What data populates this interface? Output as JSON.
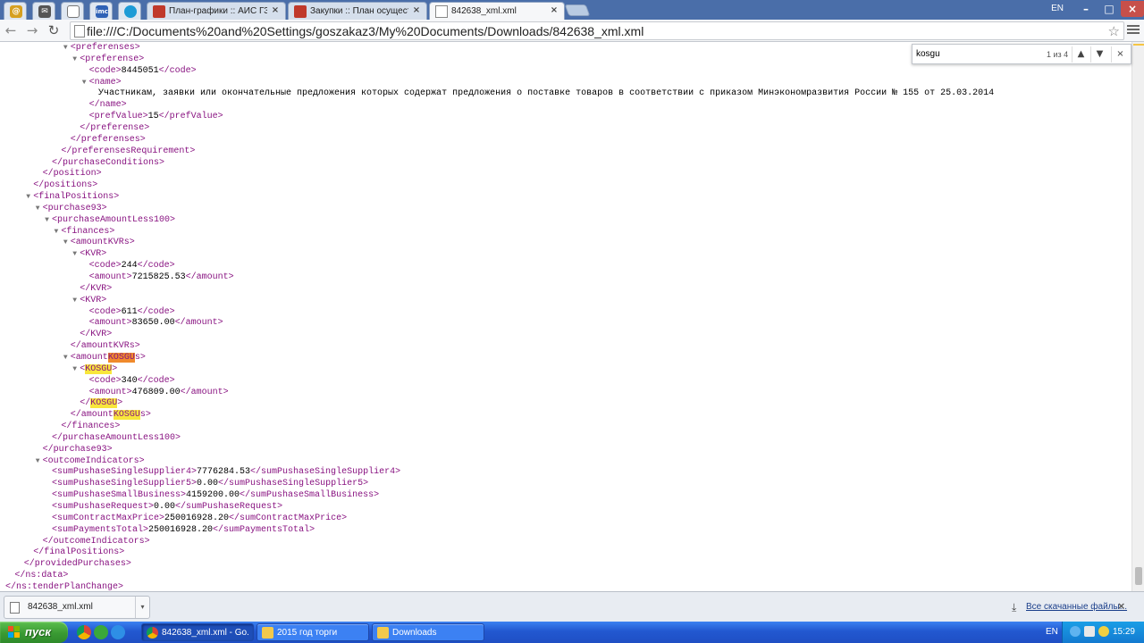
{
  "browser": {
    "tabs": [
      {
        "label": "План-графики :: АИС ГЗ",
        "close": "×"
      },
      {
        "label": "Закупки :: План осуществл",
        "close": "×"
      },
      {
        "label": "842638_xml.xml",
        "close": "×"
      }
    ],
    "ime_indicator": "EN",
    "window_buttons": {
      "minimize": "–",
      "maximize": "□",
      "close": "×"
    },
    "address": "file:///C:/Documents%20and%20Settings/goszakaz3/My%20Documents/Downloads/842638_xml.xml",
    "nav": {
      "back": "←",
      "forward": "→",
      "reload": "↻"
    }
  },
  "find_bar": {
    "query": "kosgu",
    "count": "1 из 4",
    "prev": "▲",
    "next": "▼",
    "close": "×"
  },
  "xml_lines": [
    {
      "indent": 7,
      "toggle": true,
      "segments": [
        [
          "tag",
          "<preferenses>"
        ]
      ]
    },
    {
      "indent": 8,
      "toggle": true,
      "segments": [
        [
          "tag",
          "<preferense>"
        ]
      ]
    },
    {
      "indent": 9,
      "toggle": false,
      "segments": [
        [
          "tag",
          "<code>"
        ],
        [
          "val",
          "8445051"
        ],
        [
          "tag",
          "</code>"
        ]
      ]
    },
    {
      "indent": 9,
      "toggle": true,
      "segments": [
        [
          "tag",
          "<name>"
        ]
      ]
    },
    {
      "indent": 10,
      "toggle": false,
      "segments": [
        [
          "val",
          "Участникам, заявки или окончательные предложения которых содержат предложения о поставке товаров в соответствии с приказом Минэкономразвития России № 155 от 25.03.2014"
        ]
      ]
    },
    {
      "indent": 9,
      "toggle": false,
      "segments": [
        [
          "tag",
          "</name>"
        ]
      ]
    },
    {
      "indent": 9,
      "toggle": false,
      "segments": [
        [
          "tag",
          "<prefValue>"
        ],
        [
          "val",
          "15"
        ],
        [
          "tag",
          "</prefValue>"
        ]
      ]
    },
    {
      "indent": 8,
      "toggle": false,
      "segments": [
        [
          "tag",
          "</preferense>"
        ]
      ]
    },
    {
      "indent": 7,
      "toggle": false,
      "segments": [
        [
          "tag",
          "</preferenses>"
        ]
      ]
    },
    {
      "indent": 6,
      "toggle": false,
      "segments": [
        [
          "tag",
          "</preferensesRequirement>"
        ]
      ]
    },
    {
      "indent": 5,
      "toggle": false,
      "segments": [
        [
          "tag",
          "</purchaseConditions>"
        ]
      ]
    },
    {
      "indent": 4,
      "toggle": false,
      "segments": [
        [
          "tag",
          "</position>"
        ]
      ]
    },
    {
      "indent": 3,
      "toggle": false,
      "segments": [
        [
          "tag",
          "</positions>"
        ]
      ]
    },
    {
      "indent": 3,
      "toggle": true,
      "segments": [
        [
          "tag",
          "<finalPositions>"
        ]
      ]
    },
    {
      "indent": 4,
      "toggle": true,
      "segments": [
        [
          "tag",
          "<purchase93>"
        ]
      ]
    },
    {
      "indent": 5,
      "toggle": true,
      "segments": [
        [
          "tag",
          "<purchaseAmountLess100>"
        ]
      ]
    },
    {
      "indent": 6,
      "toggle": true,
      "segments": [
        [
          "tag",
          "<finances>"
        ]
      ]
    },
    {
      "indent": 7,
      "toggle": true,
      "segments": [
        [
          "tag",
          "<amountKVRs>"
        ]
      ]
    },
    {
      "indent": 8,
      "toggle": true,
      "segments": [
        [
          "tag",
          "<KVR>"
        ]
      ]
    },
    {
      "indent": 9,
      "toggle": false,
      "segments": [
        [
          "tag",
          "<code>"
        ],
        [
          "val",
          "244"
        ],
        [
          "tag",
          "</code>"
        ]
      ]
    },
    {
      "indent": 9,
      "toggle": false,
      "segments": [
        [
          "tag",
          "<amount>"
        ],
        [
          "val",
          "7215825.53"
        ],
        [
          "tag",
          "</amount>"
        ]
      ]
    },
    {
      "indent": 8,
      "toggle": false,
      "segments": [
        [
          "tag",
          "</KVR>"
        ]
      ]
    },
    {
      "indent": 8,
      "toggle": true,
      "segments": [
        [
          "tag",
          "<KVR>"
        ]
      ]
    },
    {
      "indent": 9,
      "toggle": false,
      "segments": [
        [
          "tag",
          "<code>"
        ],
        [
          "val",
          "611"
        ],
        [
          "tag",
          "</code>"
        ]
      ]
    },
    {
      "indent": 9,
      "toggle": false,
      "segments": [
        [
          "tag",
          "<amount>"
        ],
        [
          "val",
          "83650.00"
        ],
        [
          "tag",
          "</amount>"
        ]
      ]
    },
    {
      "indent": 8,
      "toggle": false,
      "segments": [
        [
          "tag",
          "</KVR>"
        ]
      ]
    },
    {
      "indent": 7,
      "toggle": false,
      "segments": [
        [
          "tag",
          "</amountKVRs>"
        ]
      ]
    },
    {
      "indent": 7,
      "toggle": true,
      "segments": [
        [
          "tag",
          "<amount"
        ],
        [
          "hlcur",
          "KOSGU"
        ],
        [
          "tag",
          "s>"
        ]
      ]
    },
    {
      "indent": 8,
      "toggle": true,
      "segments": [
        [
          "tag",
          "<"
        ],
        [
          "hl",
          "KOSGU"
        ],
        [
          "tag",
          ">"
        ]
      ]
    },
    {
      "indent": 9,
      "toggle": false,
      "segments": [
        [
          "tag",
          "<code>"
        ],
        [
          "val",
          "340"
        ],
        [
          "tag",
          "</code>"
        ]
      ]
    },
    {
      "indent": 9,
      "toggle": false,
      "segments": [
        [
          "tag",
          "<amount>"
        ],
        [
          "val",
          "476809.00"
        ],
        [
          "tag",
          "</amount>"
        ]
      ]
    },
    {
      "indent": 8,
      "toggle": false,
      "segments": [
        [
          "tag",
          "</"
        ],
        [
          "hl",
          "KOSGU"
        ],
        [
          "tag",
          ">"
        ]
      ]
    },
    {
      "indent": 7,
      "toggle": false,
      "segments": [
        [
          "tag",
          "</amount"
        ],
        [
          "hl",
          "KOSGU"
        ],
        [
          "tag",
          "s>"
        ]
      ]
    },
    {
      "indent": 6,
      "toggle": false,
      "segments": [
        [
          "tag",
          "</finances>"
        ]
      ]
    },
    {
      "indent": 5,
      "toggle": false,
      "segments": [
        [
          "tag",
          "</purchaseAmountLess100>"
        ]
      ]
    },
    {
      "indent": 4,
      "toggle": false,
      "segments": [
        [
          "tag",
          "</purchase93>"
        ]
      ]
    },
    {
      "indent": 4,
      "toggle": true,
      "segments": [
        [
          "tag",
          "<outcomeIndicators>"
        ]
      ]
    },
    {
      "indent": 5,
      "toggle": false,
      "segments": [
        [
          "tag",
          "<sumPushaseSingleSupplier4>"
        ],
        [
          "val",
          "7776284.53"
        ],
        [
          "tag",
          "</sumPushaseSingleSupplier4>"
        ]
      ]
    },
    {
      "indent": 5,
      "toggle": false,
      "segments": [
        [
          "tag",
          "<sumPushaseSingleSupplier5>"
        ],
        [
          "val",
          "0.00"
        ],
        [
          "tag",
          "</sumPushaseSingleSupplier5>"
        ]
      ]
    },
    {
      "indent": 5,
      "toggle": false,
      "segments": [
        [
          "tag",
          "<sumPushaseSmallBusiness>"
        ],
        [
          "val",
          "4159200.00"
        ],
        [
          "tag",
          "</sumPushaseSmallBusiness>"
        ]
      ]
    },
    {
      "indent": 5,
      "toggle": false,
      "segments": [
        [
          "tag",
          "<sumPushaseRequest>"
        ],
        [
          "val",
          "0.00"
        ],
        [
          "tag",
          "</sumPushaseRequest>"
        ]
      ]
    },
    {
      "indent": 5,
      "toggle": false,
      "segments": [
        [
          "tag",
          "<sumContractMaxPrice>"
        ],
        [
          "val",
          "250016928.20"
        ],
        [
          "tag",
          "</sumContractMaxPrice>"
        ]
      ]
    },
    {
      "indent": 5,
      "toggle": false,
      "segments": [
        [
          "tag",
          "<sumPaymentsTotal>"
        ],
        [
          "val",
          "250016928.20"
        ],
        [
          "tag",
          "</sumPaymentsTotal>"
        ]
      ]
    },
    {
      "indent": 4,
      "toggle": false,
      "segments": [
        [
          "tag",
          "</outcomeIndicators>"
        ]
      ]
    },
    {
      "indent": 3,
      "toggle": false,
      "segments": [
        [
          "tag",
          "</finalPositions>"
        ]
      ]
    },
    {
      "indent": 2,
      "toggle": false,
      "segments": [
        [
          "tag",
          "</providedPurchases>"
        ]
      ]
    },
    {
      "indent": 1,
      "toggle": false,
      "segments": [
        [
          "tag",
          "</ns:data>"
        ]
      ]
    },
    {
      "indent": 0,
      "toggle": false,
      "segments": [
        [
          "tag",
          "</ns:tenderPlanChange>"
        ]
      ]
    }
  ],
  "download_shelf": {
    "file": "842638_xml.xml",
    "dropdown": "▾",
    "all_downloads": "Все скачанные файлы...",
    "close": "×"
  },
  "taskbar": {
    "start_label": "пуск",
    "tasks": [
      {
        "label": "842638_xml.xml - Go..."
      },
      {
        "label": "2015 год торги"
      },
      {
        "label": "Downloads"
      }
    ],
    "lang": "EN",
    "clock": "15:29"
  },
  "colors": {
    "tag": "#881280",
    "highlight": "#f8e63c",
    "active_highlight": "#f08a2c",
    "taskbar": "#2258d0",
    "start": "#3a9a33"
  },
  "icons": {
    "pinned": [
      "opera-icon",
      "mail-icon",
      "document-icon",
      "imc-icon",
      "firefox-icon"
    ],
    "tab": "page-icon",
    "quicklaunch": [
      "chrome-icon",
      "gear-icon",
      "ie-icon"
    ]
  }
}
